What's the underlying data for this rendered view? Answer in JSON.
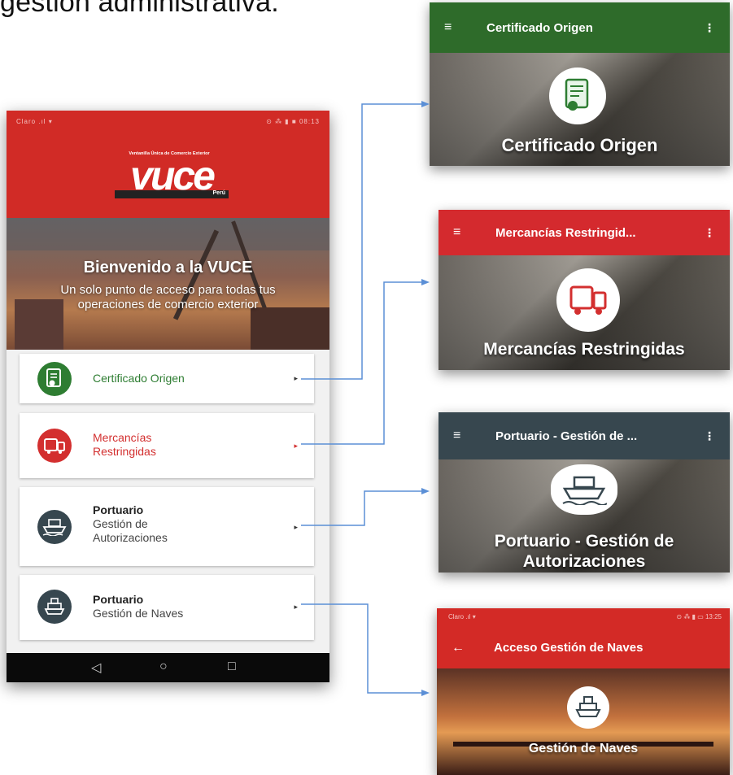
{
  "caption": "gestión administrativa.",
  "phone": {
    "status_left": "Claro  .ıl ▾",
    "status_right": "⊙ ⁂ ▮ ■ 08:13",
    "logo": {
      "tagline": "Ventanilla Única de Comercio Exterior",
      "text": "vuce",
      "country": "Perú"
    },
    "hero": {
      "title": "Bienvenido a la VUCE",
      "subtitle": "Un solo punto de acceso para todas tus operaciones de comercio exterior"
    },
    "menu": [
      {
        "line1": "Certificado Origen",
        "line2": "",
        "color": "#2e7d32",
        "icon": "certificate-icon"
      },
      {
        "line1": "Mercancías",
        "line2": "Restringidas",
        "color": "#d32f2f",
        "icon": "truck-icon"
      },
      {
        "line1": "Portuario",
        "line2": "Gestión de",
        "line3": "Autorizaciones",
        "color": "#37474f",
        "icon": "ship-icon"
      },
      {
        "line1": "Portuario",
        "line2": "Gestión de Naves",
        "color": "#37474f",
        "icon": "vessel-icon"
      }
    ],
    "arrow": "▸",
    "nav": {
      "back": "◁",
      "home": "○",
      "recent": "□"
    }
  },
  "screens": [
    {
      "title": "Certificado Origen",
      "caption": "Certificado Origen",
      "bar_color": "#2e6b2a"
    },
    {
      "title": "Mercancías Restringid...",
      "caption": "Mercancías Restringidas",
      "bar_color": "#d42a2e"
    },
    {
      "title": "Portuario - Gestión de ...",
      "caption1": "Portuario - Gestión de",
      "caption2": "Autorizaciones",
      "bar_color": "#37474f"
    },
    {
      "title": "Acceso Gestión de Naves",
      "caption": "Gestión de Naves",
      "bar_color": "#d32a26",
      "status_left": "Claro  .ıl ▾",
      "status_right": "⊙ ⁂ ▮ ▭ 13:25"
    }
  ],
  "glyphs": {
    "menu": "≡",
    "more": "⋮",
    "back": "←"
  }
}
